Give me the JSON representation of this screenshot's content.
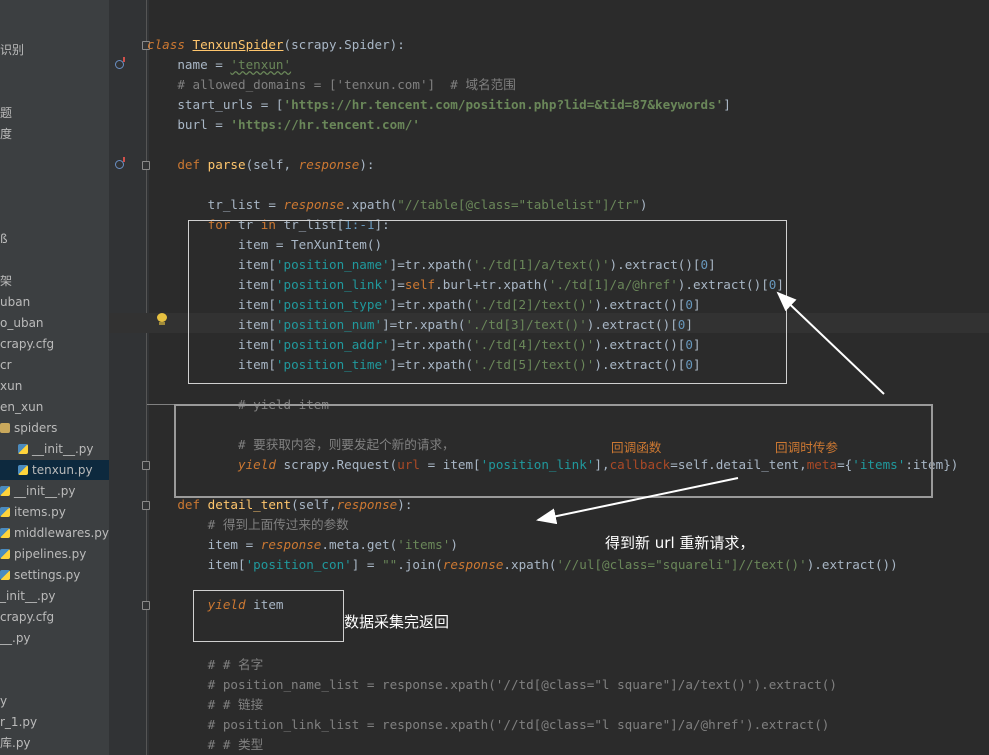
{
  "sidebar": {
    "items": [
      {
        "label": "识别",
        "icon": "none"
      },
      {
        "label": "题",
        "icon": "none"
      },
      {
        "label": "度",
        "icon": "none"
      },
      {
        "label": "ß",
        "icon": "none"
      },
      {
        "label": "架",
        "icon": "none"
      },
      {
        "label": "uban",
        "icon": "none"
      },
      {
        "label": "o_uban",
        "icon": "none"
      },
      {
        "label": "crapy.cfg",
        "icon": "none"
      },
      {
        "label": "cr",
        "icon": "none"
      },
      {
        "label": "xun",
        "icon": "none"
      },
      {
        "label": "en_xun",
        "icon": "none"
      },
      {
        "label": "spiders",
        "icon": "folder-icon"
      },
      {
        "label": "__init__.py",
        "icon": "python-file-icon"
      },
      {
        "label": "tenxun.py",
        "icon": "python-file-icon",
        "selected": true
      },
      {
        "label": "__init__.py",
        "icon": "python-file-icon"
      },
      {
        "label": "items.py",
        "icon": "python-file-icon"
      },
      {
        "label": "middlewares.py",
        "icon": "python-file-icon"
      },
      {
        "label": "pipelines.py",
        "icon": "python-file-icon"
      },
      {
        "label": "settings.py",
        "icon": "python-file-icon"
      },
      {
        "label": "_init__.py",
        "icon": "none"
      },
      {
        "label": "crapy.cfg",
        "icon": "none"
      },
      {
        "label": "__.py",
        "icon": "none"
      },
      {
        "label": "y",
        "icon": "none"
      },
      {
        "label": "r_1.py",
        "icon": "none"
      },
      {
        "label": "库.py",
        "icon": "none"
      }
    ]
  },
  "code": {
    "l1_class": "class ",
    "l1_name": "TenxunSpider",
    "l1_rest": "(scrapy.Spider):",
    "l2_a": "    name = ",
    "l2_b": "'tenxun'",
    "l3": "    # allowed_domains = ['tenxun.com']  # 域名范围",
    "l4_a": "    start_urls = [",
    "l4_b": "'https://hr.tencent.com/position.php?lid=&tid=87&keywords'",
    "l4_c": "]",
    "l5_a": "    burl = ",
    "l5_b": "'https://hr.tencent.com/'",
    "l6_def": "    def ",
    "l6_fn": "parse",
    "l6_a": "(self, ",
    "l6_p": "response",
    "l6_b": "):",
    "l7_a": "        tr_list = ",
    "l7_p": "response",
    "l7_b": ".xpath(",
    "l7_s": "\"//table[@class=\"tablelist\"]/tr\"",
    "l7_c": ")",
    "l8_for": "        for",
    "l8_a": " tr ",
    "l8_in": "in",
    "l8_b": " tr_list[",
    "l8_n": "1:-1",
    "l8_c": "]:",
    "l9": "            item = TenXunItem()",
    "l10_k": "'position_name'",
    "l10_x": "'./td[1]/a/text()'",
    "l11_k": "'position_link'",
    "l11_x": "'./td[1]/a/@href'",
    "l12_k": "'position_type'",
    "l12_x": "'./td[2]/text()'",
    "l13_k": "'position_num'",
    "l13_x": "'./td[3]/text()'",
    "l14_k": "'position_addr'",
    "l14_x": "'./td[4]/text()'",
    "l15_k": "'position_time'",
    "l15_x": "'./td[5]/text()'",
    "l16": "            # yield item",
    "l17": "            # 要获取内容，则要发起个新的请求，",
    "l17_n1": "回调函数",
    "l17_n2": "回调时传参",
    "l18_y": "            yield",
    "l18_a": " scrapy.Request(",
    "l18_url": "url",
    "l18_b": " = item[",
    "l18_k": "'position_link'",
    "l18_c": "],",
    "l18_cb": "callback",
    "l18_d": "=self.detail_tent,",
    "l18_meta": "meta",
    "l18_e": "={",
    "l18_mk": "'items'",
    "l18_f": ":item})",
    "l19_def": "    def ",
    "l19_fn": "detail_tent",
    "l19_a": "(self,",
    "l19_p": "response",
    "l19_b": "):",
    "l20": "        # 得到上面传过来的参数",
    "l21_a": "        item = ",
    "l21_p": "response",
    "l21_b": ".meta.get(",
    "l21_s": "'items'",
    "l21_c": ")",
    "l22_a": "        item[",
    "l22_k": "'position_con'",
    "l22_b": "] = ",
    "l22_s": "\"\"",
    "l22_c": ".join(",
    "l22_p": "response",
    "l22_d": ".xpath(",
    "l22_x": "'//ul[@class=\"squareli\"]//text()'",
    "l22_e": ").extract())",
    "l23_y": "        yield",
    "l23_a": " item",
    "l24": "        # # 名字",
    "l25": "        # position_name_list = response.xpath('//td[@class=\"l square\"]/a/text()').extract()",
    "l26": "        # # 链接",
    "l27": "        # position_link_list = response.xpath('//td[@class=\"l square\"]/a/@href').extract()",
    "l28": "        # # 类型"
  },
  "annotations": {
    "new_request": "得到新 url  重新请求，",
    "done_return": "数据采集完返回"
  }
}
